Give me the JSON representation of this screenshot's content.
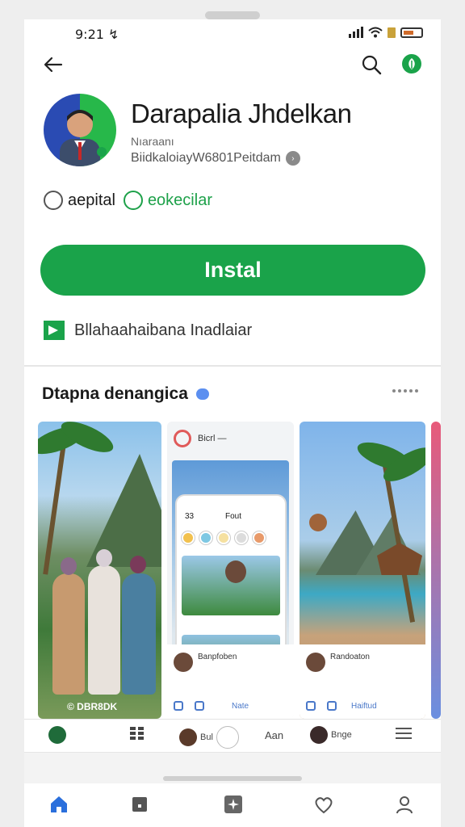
{
  "status_bar": {
    "time": "9:21 ↯"
  },
  "topbar": {
    "back_icon": "arrow-left-icon",
    "search_icon": "search-icon",
    "brand_icon": "leaf-icon"
  },
  "app": {
    "title": "Darapalia Jhdelkan",
    "subtitle": "Nıaraanı",
    "developer": "BiidkaloiayW6801Peitdam",
    "developer_badge": "›"
  },
  "chips": [
    {
      "label": "aepital"
    },
    {
      "label": "eokecilar"
    }
  ],
  "install_button": {
    "label": "Instal",
    "color": "#1aa34a"
  },
  "note": {
    "text": "Bllahaahaibana Inadlaiar"
  },
  "screenshots_section": {
    "title": "Dtapna denangica",
    "shot1_caption": "© DBR8DK",
    "shot2_header": "Bicrl —",
    "shot2_inner_top": "33",
    "shot2_inner_name": "Fout",
    "shot2_card_name": "Banpfoben",
    "shot2_card_sub": "Nate",
    "shot3_card_name": "Randoaton",
    "shot3_card_sub": "Haiftud"
  },
  "tab_row": [
    {
      "label": ""
    },
    {
      "label": ""
    },
    {
      "label": "Bul"
    },
    {
      "label": "Aan"
    },
    {
      "label": "Bnge"
    },
    {
      "label": ""
    }
  ],
  "bottom_nav": [
    {
      "icon": "home-icon"
    },
    {
      "icon": "apps-icon"
    },
    {
      "icon": "sparkle-icon"
    },
    {
      "icon": "heart-icon"
    },
    {
      "icon": "profile-icon"
    }
  ],
  "colors": {
    "accent": "#1aa34a",
    "text": "#1a1a1a",
    "nav_active": "#2a6fdc"
  }
}
